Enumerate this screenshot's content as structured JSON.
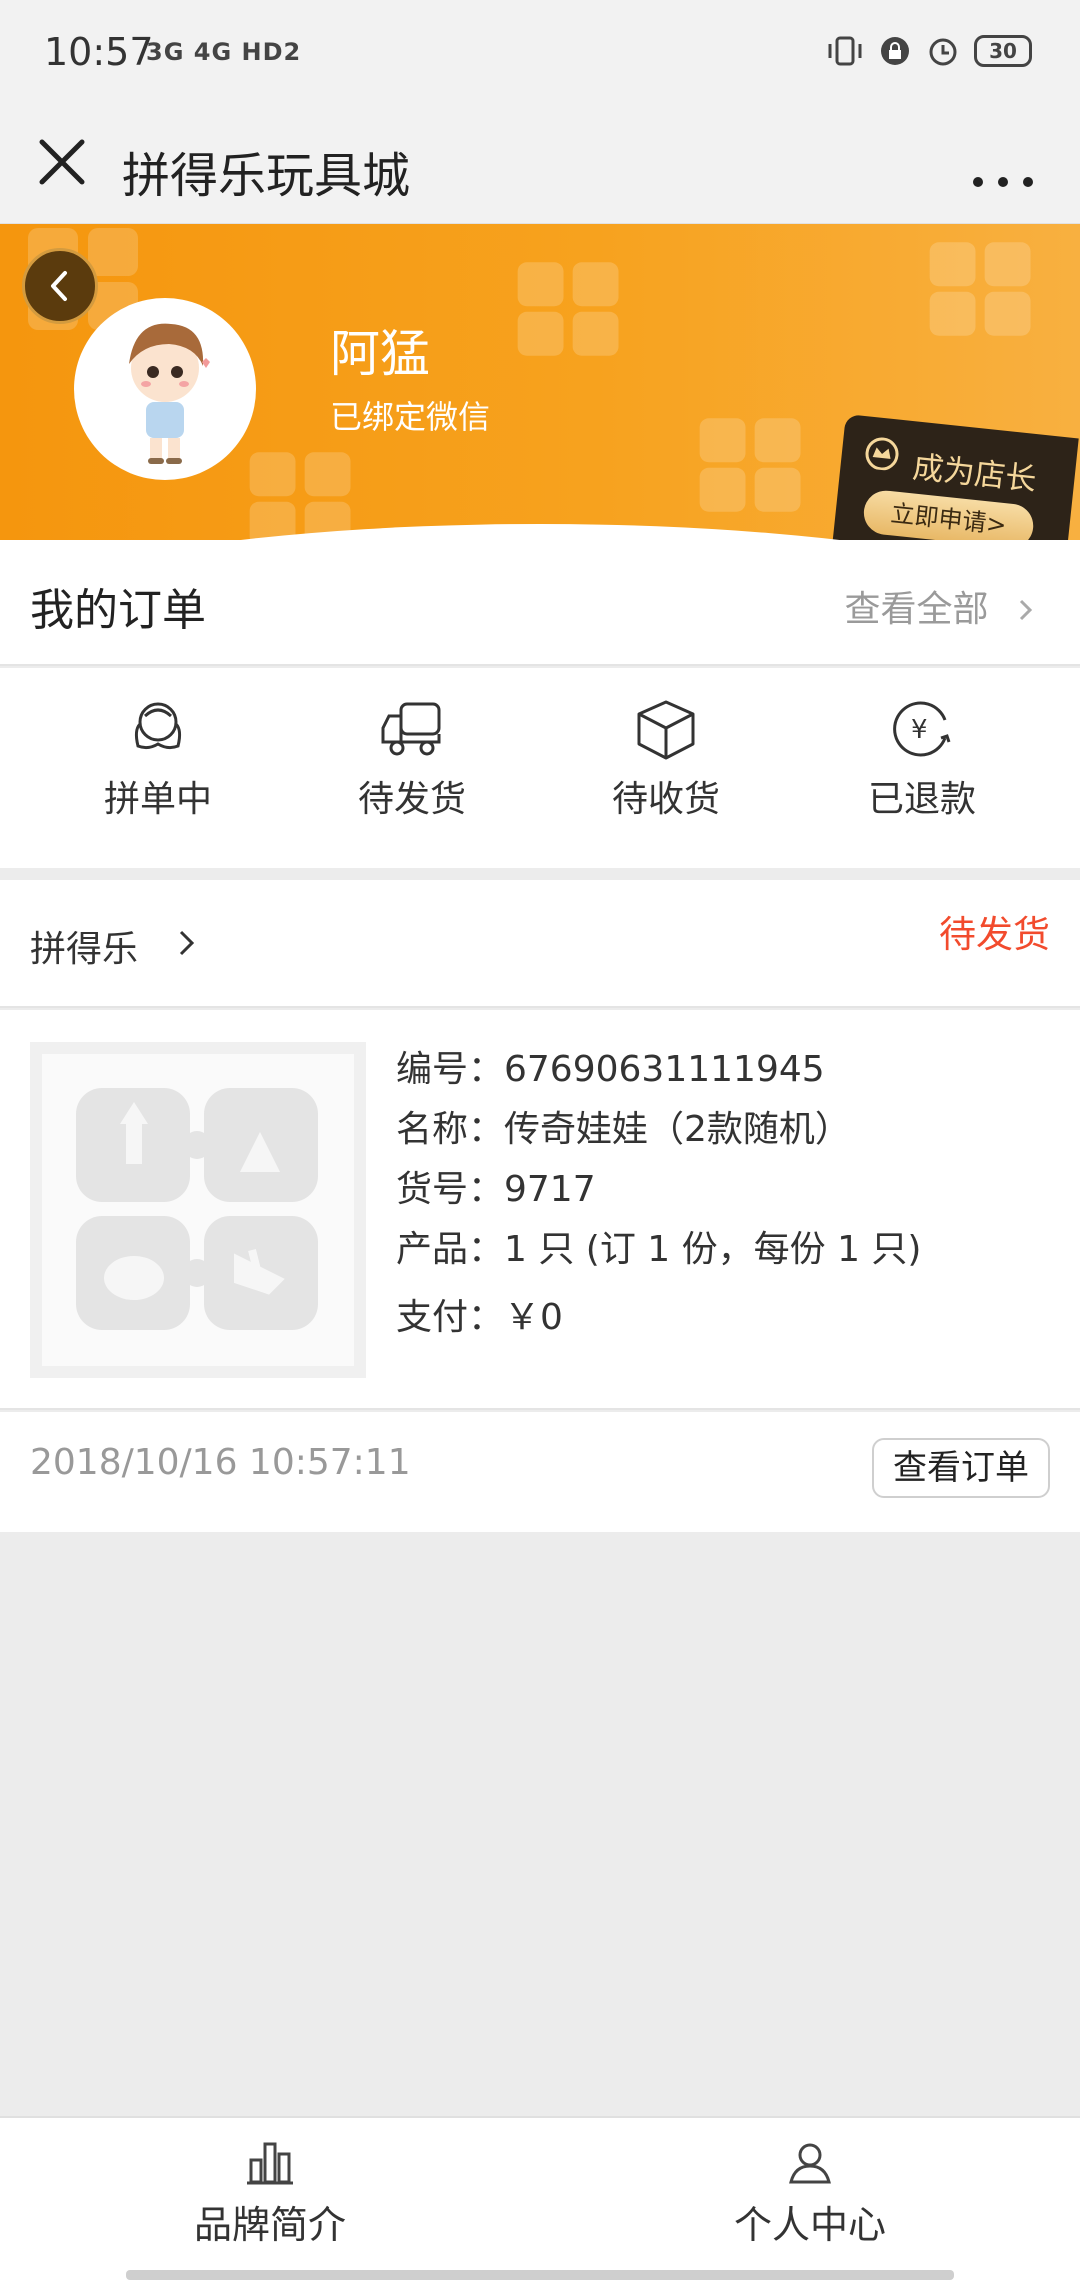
{
  "status_bar": {
    "time": "10:57",
    "network": "3G 4G HD2",
    "battery": "30"
  },
  "nav": {
    "title": "拼得乐玩具城"
  },
  "profile": {
    "name": "阿猛",
    "bound_text": "已绑定微信",
    "shop_badge_title": "成为店长",
    "shop_badge_button": "立即申请>"
  },
  "orders": {
    "title": "我的订单",
    "view_all": "查看全部",
    "statuses": [
      {
        "label": "拼单中",
        "icon": "group-buy-icon"
      },
      {
        "label": "待发货",
        "icon": "truck-icon"
      },
      {
        "label": "待收货",
        "icon": "box-icon"
      },
      {
        "label": "已退款",
        "icon": "refund-icon"
      }
    ]
  },
  "order_card": {
    "shop": "拼得乐",
    "status": "待发货",
    "lines": [
      "编号：67690631111945",
      "名称：传奇娃娃（2款随机）",
      "货号：9717",
      "产品：1 只 (订 1 份，每份 1 只)",
      "支付：￥0"
    ],
    "time": "2018/10/16 10:57:11",
    "view_button": "查看订单"
  },
  "tabbar": {
    "items": [
      {
        "label": "品牌简介",
        "icon": "chart-bar-icon"
      },
      {
        "label": "个人中心",
        "icon": "person-icon"
      }
    ]
  },
  "colors": {
    "banner": "#f5960e",
    "status_red": "#f24b2d"
  }
}
